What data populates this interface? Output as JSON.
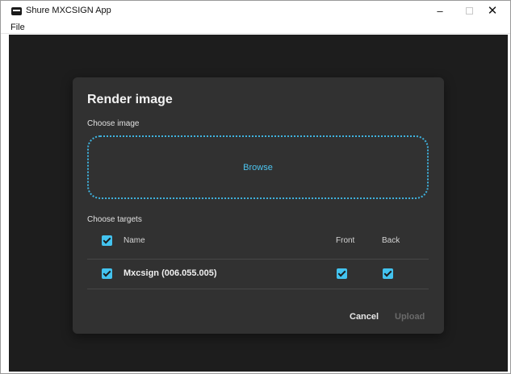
{
  "window": {
    "title": "Shure MXCSIGN App",
    "minimize_glyph": "–",
    "close_glyph": "✕"
  },
  "menu": {
    "file": "File"
  },
  "dialog": {
    "title": "Render image",
    "choose_image_label": "Choose image",
    "browse_label": "Browse",
    "choose_targets_label": "Choose targets",
    "columns": {
      "name": "Name",
      "front": "Front",
      "back": "Back"
    },
    "targets": [
      {
        "name": "Mxcsign (006.055.005)",
        "selected": true,
        "front": true,
        "back": true
      }
    ],
    "select_all": true,
    "cancel_label": "Cancel",
    "upload_label": "Upload"
  },
  "colors": {
    "accent": "#43c3ef",
    "dialog_bg": "#313131",
    "app_bg": "#1d1d1d",
    "disabled_text": "#6a6a6a"
  }
}
